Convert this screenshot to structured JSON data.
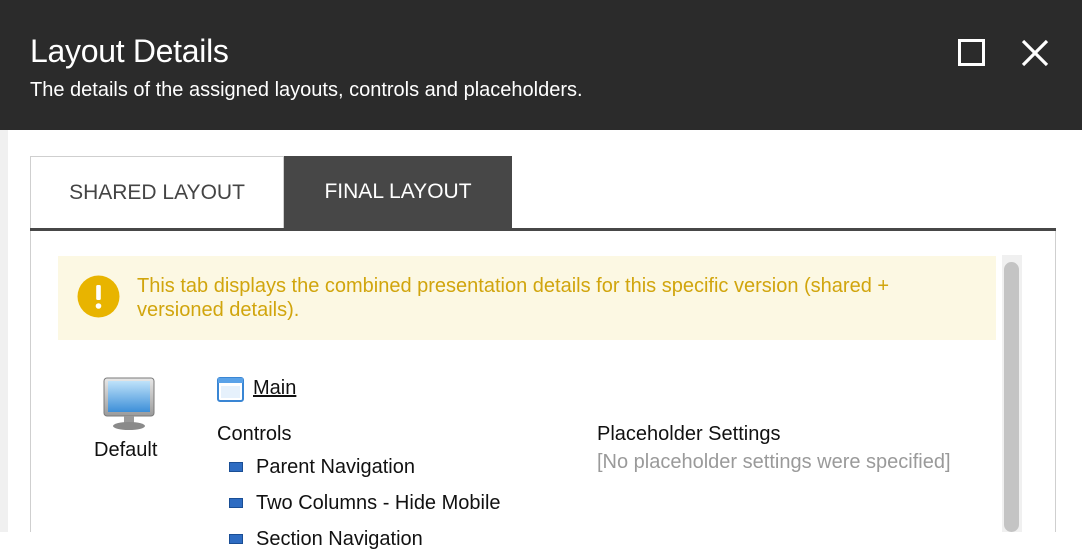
{
  "dialog": {
    "title": "Layout Details",
    "subtitle": "The details of the assigned layouts, controls and placeholders.",
    "maximize_icon": "maximize-icon",
    "close_icon": "close-icon"
  },
  "tabs": [
    {
      "label": "SHARED LAYOUT",
      "active": false
    },
    {
      "label": "FINAL LAYOUT",
      "active": true
    }
  ],
  "notice": {
    "icon": "warning-icon",
    "text": "This tab displays the combined presentation details for this specific version (shared + versioned details).",
    "color": "#d1a50d",
    "background": "#fcf8e3"
  },
  "device": {
    "icon": "monitor-icon",
    "label": "Default"
  },
  "layout": {
    "icon": "layout-window-icon",
    "name": "Main"
  },
  "controls": {
    "heading": "Controls",
    "items": [
      {
        "label": "Parent Navigation",
        "icon": "control-icon"
      },
      {
        "label": "Two Columns - Hide Mobile",
        "icon": "control-icon"
      },
      {
        "label": "Section Navigation",
        "icon": "control-icon"
      }
    ]
  },
  "placeholder_settings": {
    "heading": "Placeholder Settings",
    "empty_text": "[No placeholder settings were specified]"
  },
  "colors": {
    "header_bg": "#2b2b2b",
    "active_tab_bg": "#474747",
    "control_icon": "#2e6cc2"
  }
}
